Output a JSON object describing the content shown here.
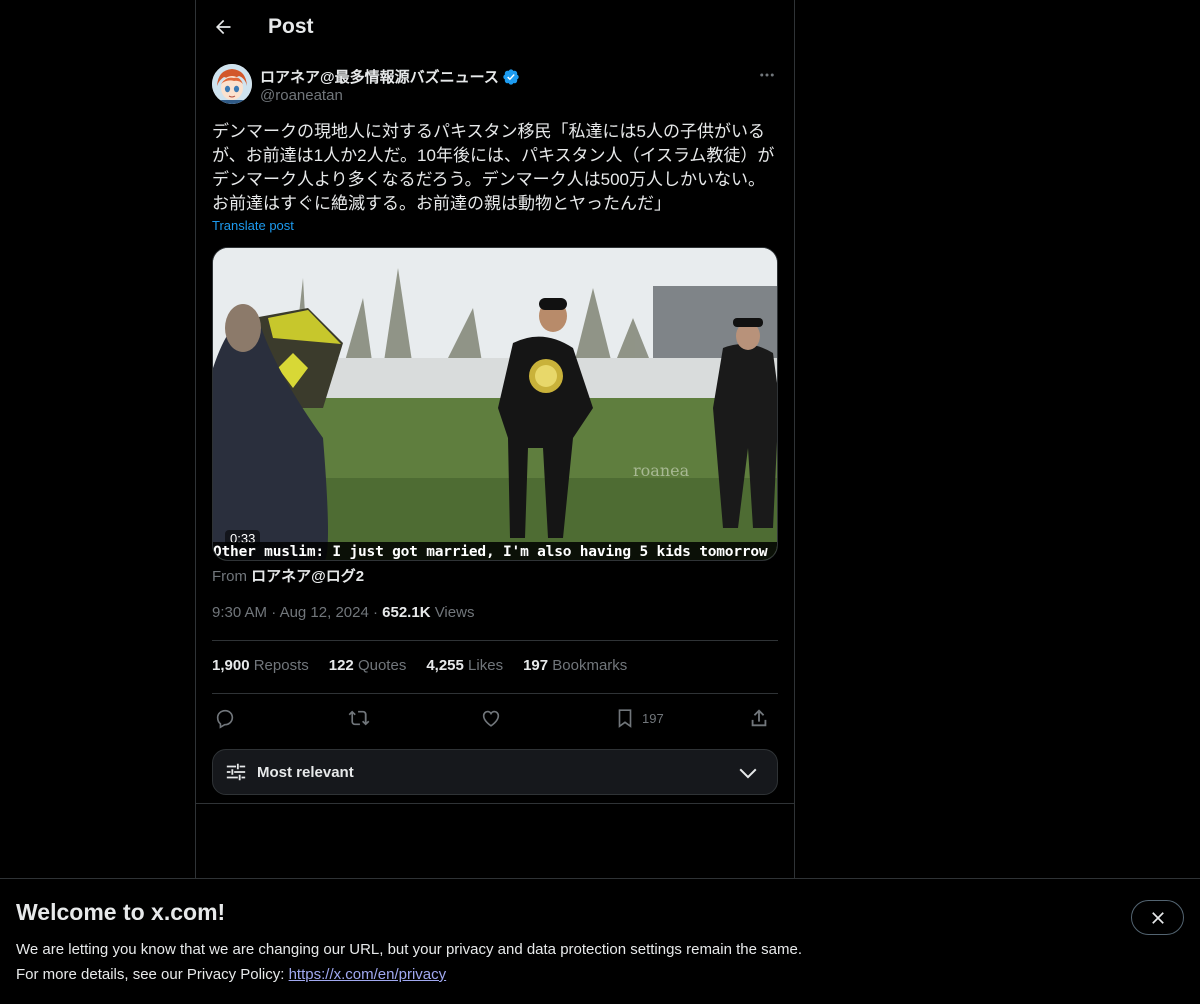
{
  "header": {
    "title": "Post"
  },
  "author": {
    "name": "ロアネア@最多情報源バズニュース",
    "handle": "@roaneatan",
    "verified_color": "#1d9bf0"
  },
  "tweet": {
    "lines": [
      "デンマークの現地人に対するパキスタン移民「私達には5人の子供がいる",
      "が、お前達は1人か2人だ。10年後には、パキスタン人（イスラム教徒）が",
      "デンマーク人より多くなるだろう。デンマーク人は500万人しかいない。",
      "お前達はすぐに絶滅する。お前達の親は動物とヤったんだ」"
    ],
    "translate_label": "Translate post"
  },
  "media": {
    "duration": "0:33",
    "subtitle": "Other muslim: I just got married, I'm also having 5 kids tomorrow",
    "watermark": "roanea"
  },
  "from": {
    "prefix": "From",
    "source": "ロアネア@ログ2"
  },
  "meta": {
    "time": "9:30 AM",
    "date": "Aug 12, 2024",
    "views_count": "652.1K",
    "views_label": "Views"
  },
  "stats": {
    "reposts_count": "1,900",
    "reposts_label": "Reposts",
    "quotes_count": "122",
    "quotes_label": "Quotes",
    "likes_count": "4,255",
    "likes_label": "Likes",
    "bookmarks_count": "197",
    "bookmarks_label": "Bookmarks"
  },
  "actions": {
    "bookmark_count": "197"
  },
  "sort": {
    "label": "Most relevant"
  },
  "banner": {
    "title": "Welcome to x.com!",
    "line1": "We are letting you know that we are changing our URL, but your privacy and data protection settings remain the same.",
    "line2_prefix": "For more details, see our Privacy Policy: ",
    "link": "https://x.com/en/privacy"
  }
}
